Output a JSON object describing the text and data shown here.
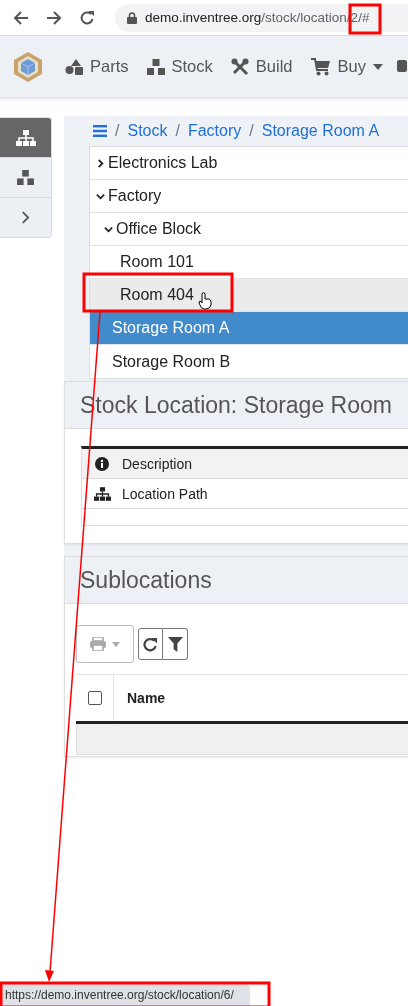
{
  "browser": {
    "host": "demo.inventree.org",
    "path": "/stock/location/2/#",
    "status_url": "https://demo.inventree.org/stock/location/6/"
  },
  "navbar": {
    "items": [
      {
        "label": "Parts",
        "dropdown": false
      },
      {
        "label": "Stock",
        "dropdown": false
      },
      {
        "label": "Build",
        "dropdown": false
      },
      {
        "label": "Buy",
        "dropdown": true
      }
    ]
  },
  "sidebar": {
    "items": [
      {
        "selected": true
      },
      {
        "selected": false
      }
    ]
  },
  "breadcrumb": [
    {
      "separator": "/",
      "label": "Stock"
    },
    {
      "separator": "/",
      "label": "Factory"
    },
    {
      "separator": "/",
      "label": "Storage Room A"
    }
  ],
  "tree": [
    {
      "label": "Electronics Lab",
      "expanded": false,
      "selected": false,
      "hovered": false
    },
    {
      "label": "Factory",
      "expanded": true,
      "selected": false,
      "hovered": false,
      "children": [
        {
          "label": "Office Block",
          "expanded": true,
          "selected": false,
          "hovered": false,
          "children": [
            {
              "label": "Room 101",
              "selected": false,
              "hovered": false
            },
            {
              "label": "Room 404",
              "selected": false,
              "hovered": true
            }
          ]
        },
        {
          "label": "Storage Room A",
          "selected": true,
          "hovered": false
        },
        {
          "label": "Storage Room B",
          "selected": false,
          "hovered": false
        }
      ]
    }
  ],
  "location_panel": {
    "title": "Stock Location: Storage Room",
    "details": [
      {
        "label": "Description"
      },
      {
        "label": "Location Path"
      }
    ]
  },
  "sublocations_panel": {
    "title": "Sublocations",
    "print_disabled": true,
    "select_all_checked": false,
    "columns": [
      "Name"
    ]
  }
}
